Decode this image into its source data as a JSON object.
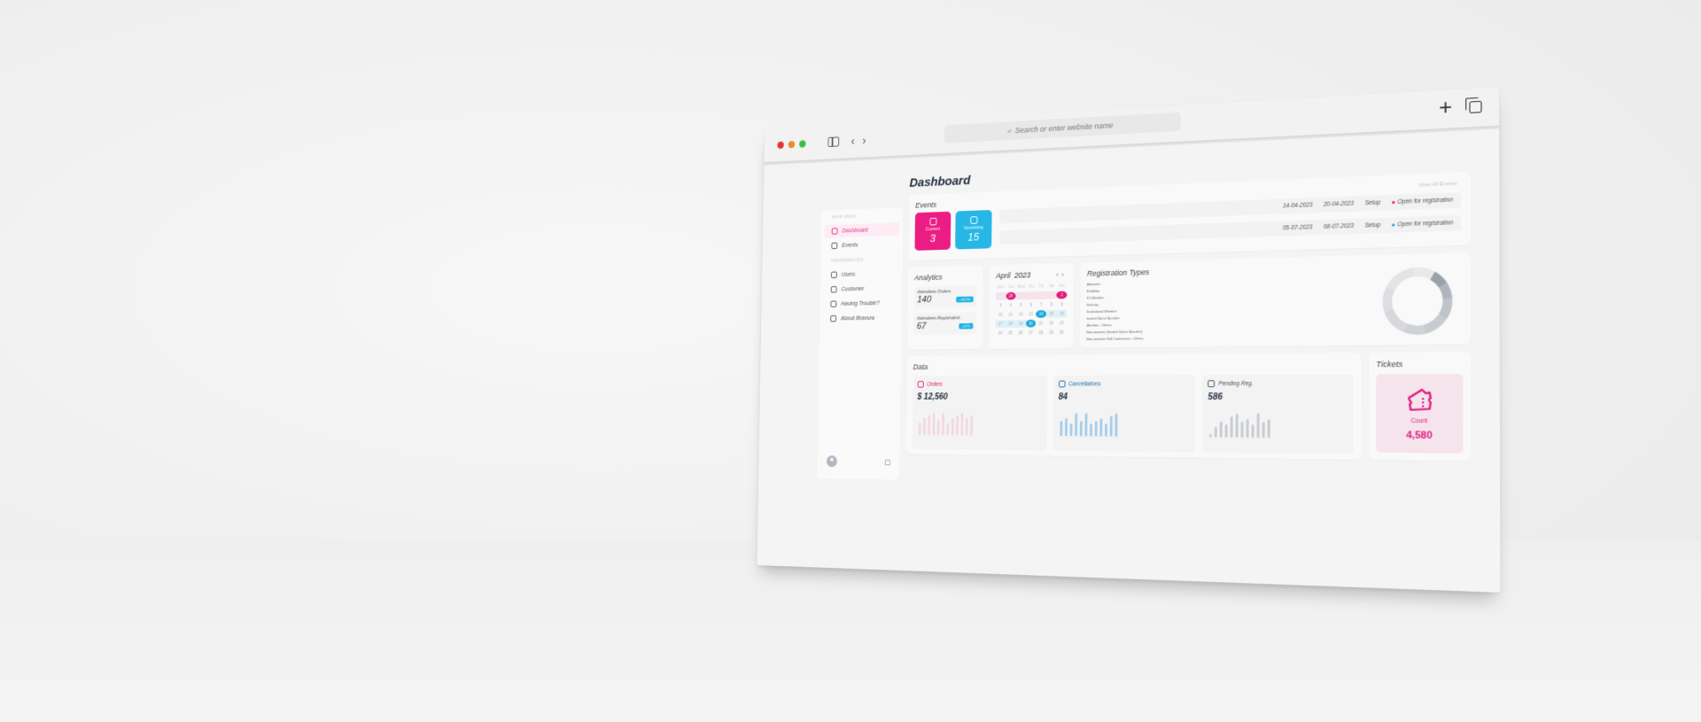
{
  "colors": {
    "pink": "#e3197d",
    "blue": "#1ba7d8",
    "dark": "#1f2b3b",
    "muted": "#aaaaaa"
  },
  "browser": {
    "traffic_lights": [
      "#e5372f",
      "#ef8b2c",
      "#3fbd3f"
    ],
    "url_placeholder": "Search or enter website name",
    "icons": {
      "search": "search-icon",
      "sidebar": "sidebar-toggle-icon",
      "back": "‹",
      "forward": "›",
      "new_tab": "+",
      "tabs": "tabs-overview-icon"
    }
  },
  "sidebar": {
    "sections": [
      {
        "title": "Main Menu",
        "items": [
          {
            "label": "Dashboard",
            "icon": "dashboard-icon",
            "active": true
          },
          {
            "label": "Events",
            "icon": "calendar-icon",
            "active": false
          }
        ]
      },
      {
        "title": "Preferences",
        "items": [
          {
            "label": "Users",
            "icon": "users-icon"
          },
          {
            "label": "Customer",
            "icon": "user-icon"
          },
          {
            "label": "Having Trouble?",
            "icon": "phone-icon"
          },
          {
            "label": "About Bravura",
            "icon": "info-icon"
          }
        ]
      }
    ]
  },
  "page": {
    "title": "Dashboard"
  },
  "events": {
    "title": "Events",
    "view_all": "View All Events",
    "tiles": [
      {
        "label": "Current",
        "value": "3",
        "color": "#ec1c85"
      },
      {
        "label": "Upcoming",
        "value": "15",
        "color": "#26b7e6"
      }
    ],
    "rows": [
      {
        "start": "14-04-2023",
        "end": "20-04-2023",
        "stage": "Setup",
        "status": "Open for registration",
        "dot": "#e3197d"
      },
      {
        "start": "05-07-2023",
        "end": "08-07-2023",
        "stage": "Setup",
        "status": "Open for registration",
        "dot": "#1ba7d8"
      }
    ]
  },
  "analytics": {
    "title": "Analytics",
    "metrics": [
      {
        "label": "Attendees Orders",
        "value": "140",
        "badge": "+18.2%"
      },
      {
        "label": "Attendees Registration",
        "value": "67",
        "badge": "+27%"
      }
    ]
  },
  "calendar": {
    "month": "April",
    "year": "2023",
    "prev": "‹",
    "next": "›",
    "weekdays": [
      "Mon",
      "Tue",
      "Wed",
      "Thu",
      "Fri",
      "Sat",
      "Sun"
    ],
    "weeks": [
      [
        "",
        "29",
        "",
        "",
        "",
        "",
        "2"
      ],
      [
        "3",
        "4",
        "5",
        "6",
        "7",
        "8",
        "9"
      ],
      [
        "10",
        "11",
        "12",
        "13",
        "14",
        "15",
        "16"
      ],
      [
        "17",
        "18",
        "19",
        "20",
        "21",
        "22",
        "23"
      ],
      [
        "24",
        "25",
        "26",
        "27",
        "28",
        "29",
        "30"
      ]
    ],
    "pink_range": [
      "29",
      "2"
    ],
    "blue_range": [
      "14",
      "20"
    ]
  },
  "registration_types": {
    "title": "Registration Types",
    "items": [
      "Attendee",
      "Exhibitor",
      "ICI Member",
      "Industry",
      "Institutional Member",
      "Invited Guest Speaker",
      "Member - Others",
      "Non-member (Invited Guest Speaker)",
      "Non-member Full Conference - Others"
    ],
    "shares": [
      0.08,
      0.08,
      0.1,
      0.12,
      0.1,
      0.14,
      0.12,
      0.16,
      0.1
    ]
  },
  "data": {
    "title": "Data",
    "cards": [
      {
        "label": "Orders",
        "value": "$ 12,560",
        "label_color": "#e3197d",
        "bar_color": "#f2d8e2",
        "bars": [
          0.5,
          0.7,
          0.8,
          0.9,
          0.6,
          0.9,
          0.5,
          0.7,
          0.8,
          0.9,
          0.7,
          0.8
        ]
      },
      {
        "label": "Cancellations",
        "value": "84",
        "label_color": "#1b6fb5",
        "bar_color": "#a7cdea",
        "bars": [
          0.6,
          0.7,
          0.5,
          0.9,
          0.6,
          0.9,
          0.5,
          0.6,
          0.7,
          0.5,
          0.8,
          0.9
        ]
      },
      {
        "label": "Pending Reg.",
        "value": "586",
        "label_color": "#555555",
        "bar_color": "#c9cdd1",
        "bars": [
          0.15,
          0.4,
          0.6,
          0.5,
          0.8,
          0.9,
          0.6,
          0.7,
          0.5,
          0.95,
          0.6,
          0.7
        ]
      }
    ]
  },
  "tickets": {
    "title": "Tickets",
    "label": "Count",
    "value": "4,580"
  }
}
